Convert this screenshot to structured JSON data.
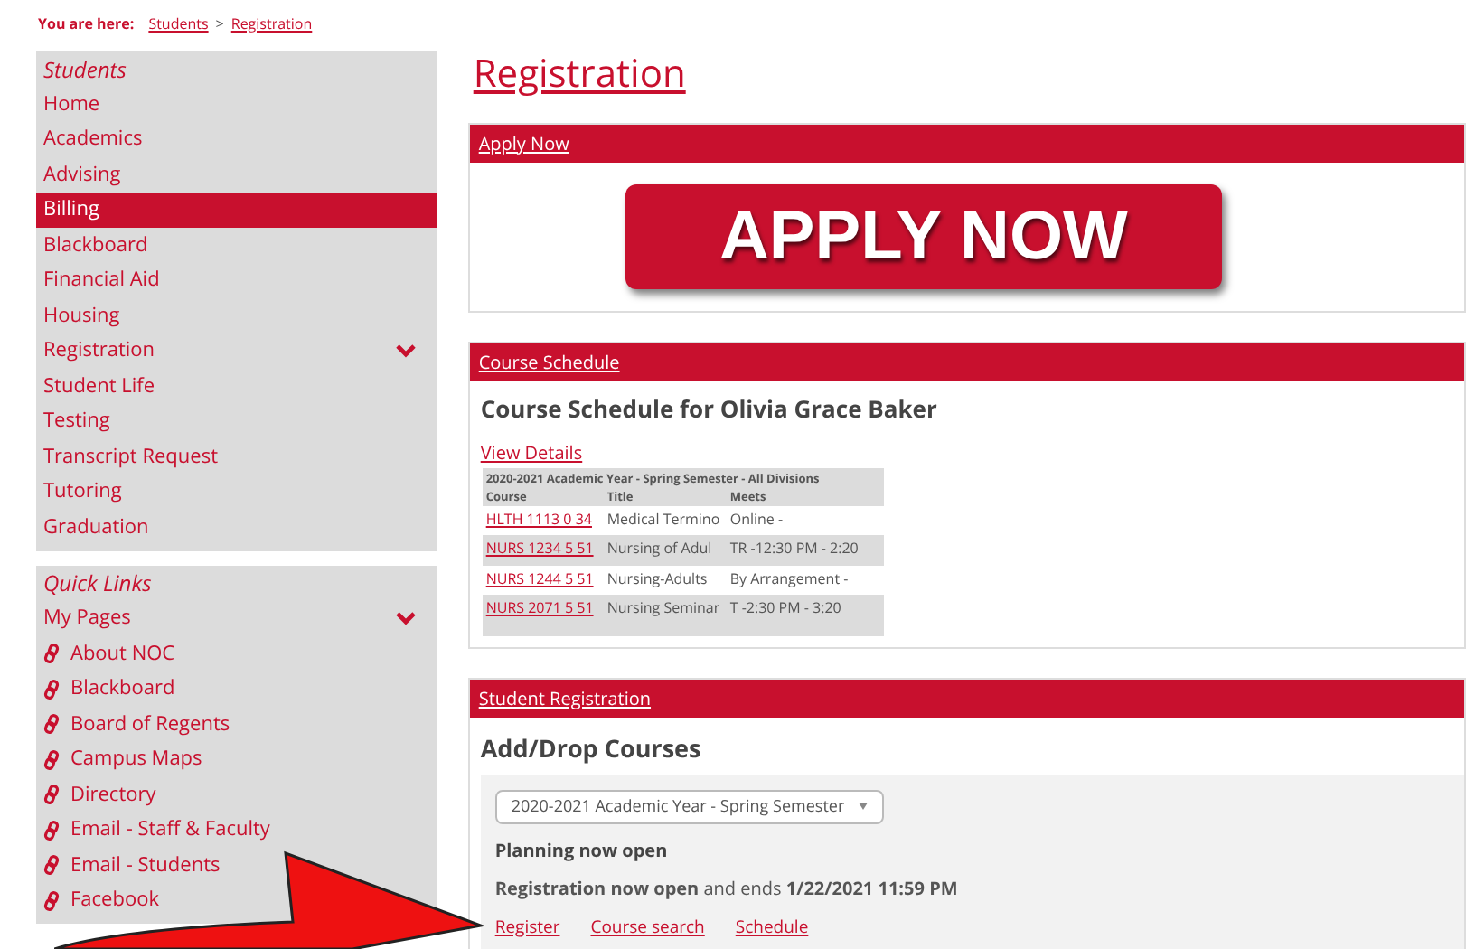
{
  "breadcrumb": {
    "label": "You are here:",
    "links": [
      "Students",
      "Registration"
    ],
    "separator": ">"
  },
  "sidebar": {
    "sections": [
      {
        "title": "Students",
        "items": [
          {
            "label": "Home",
            "kind": "plain",
            "selected": false,
            "has_submenu": false
          },
          {
            "label": "Academics",
            "kind": "plain",
            "selected": false,
            "has_submenu": false
          },
          {
            "label": "Advising",
            "kind": "plain",
            "selected": false,
            "has_submenu": false
          },
          {
            "label": "Billing",
            "kind": "plain",
            "selected": true,
            "has_submenu": false
          },
          {
            "label": "Blackboard",
            "kind": "plain",
            "selected": false,
            "has_submenu": false
          },
          {
            "label": "Financial Aid",
            "kind": "plain",
            "selected": false,
            "has_submenu": false
          },
          {
            "label": "Housing",
            "kind": "plain",
            "selected": false,
            "has_submenu": false
          },
          {
            "label": "Registration",
            "kind": "plain",
            "selected": false,
            "has_submenu": true
          },
          {
            "label": "Student Life",
            "kind": "plain",
            "selected": false,
            "has_submenu": false
          },
          {
            "label": "Testing",
            "kind": "plain",
            "selected": false,
            "has_submenu": false
          },
          {
            "label": "Transcript Request",
            "kind": "plain",
            "selected": false,
            "has_submenu": false
          },
          {
            "label": "Tutoring",
            "kind": "plain",
            "selected": false,
            "has_submenu": false
          },
          {
            "label": "Graduation",
            "kind": "plain",
            "selected": false,
            "has_submenu": false
          }
        ]
      },
      {
        "title": "Quick Links",
        "items": [
          {
            "label": "My Pages",
            "kind": "plain",
            "selected": false,
            "has_submenu": true
          },
          {
            "label": "About NOC",
            "kind": "external",
            "selected": false,
            "has_submenu": false
          },
          {
            "label": "Blackboard",
            "kind": "external",
            "selected": false,
            "has_submenu": false
          },
          {
            "label": "Board of Regents",
            "kind": "external",
            "selected": false,
            "has_submenu": false
          },
          {
            "label": "Campus Maps",
            "kind": "external",
            "selected": false,
            "has_submenu": false
          },
          {
            "label": "Directory",
            "kind": "external",
            "selected": false,
            "has_submenu": false
          },
          {
            "label": "Email - Staff & Faculty",
            "kind": "external",
            "selected": false,
            "has_submenu": false
          },
          {
            "label": "Email - Students",
            "kind": "external",
            "selected": false,
            "has_submenu": false
          },
          {
            "label": "Facebook",
            "kind": "external",
            "selected": false,
            "has_submenu": false
          }
        ]
      }
    ]
  },
  "page_title": "Registration",
  "apply_panel": {
    "header": "Apply Now",
    "button": "APPLY NOW"
  },
  "schedule_panel": {
    "header": "Course Schedule",
    "heading": "Course Schedule for Olivia Grace Baker",
    "details_link": "View Details",
    "table": {
      "caption": "2020-2021 Academic Year - Spring Semester - All Divisions",
      "columns": [
        "Course",
        "Title",
        "Meets"
      ],
      "rows": [
        [
          "HLTH 1113 0 34",
          "Medical Termino",
          "Online -"
        ],
        [
          "NURS 1234 5 51",
          "Nursing of Adul",
          "TR -12:30 PM - 2:20"
        ],
        [
          "NURS 1244 5 51",
          "Nursing-Adults",
          "By Arrangement -"
        ],
        [
          "NURS 2071 5 51",
          "Nursing Seminar",
          "T -2:30 PM - 3:20"
        ]
      ]
    }
  },
  "registration_panel": {
    "header": "Student Registration",
    "heading": "Add/Drop Courses",
    "term_select": "2020-2021 Academic Year - Spring Semester",
    "planning_status": "Planning now open",
    "registration_status": "**Registration now open** and ends **1/22/2021 11:59 PM**",
    "links": [
      "Register",
      "Course search",
      "Schedule"
    ]
  }
}
